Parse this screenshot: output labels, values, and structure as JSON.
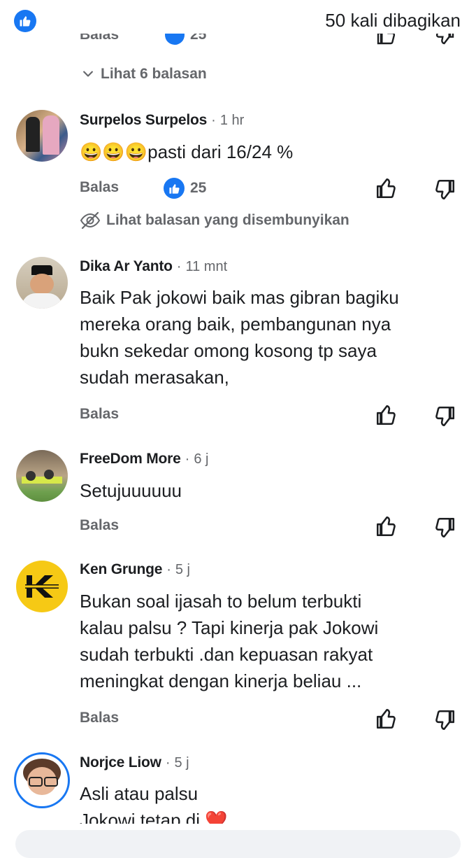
{
  "header": {
    "shares_text": "50 kali dibagikan"
  },
  "previous": {
    "view_replies": "Lihat 6 balasan"
  },
  "comments": [
    {
      "name": "Surpelos Surpelos",
      "time": "1 hr",
      "text_emoji": "😀😀😀",
      "text": "pasti dari  16/24 %",
      "reply_label": "Balas",
      "like_count": "25",
      "hidden_replies": "Lihat balasan yang disembunyikan"
    },
    {
      "name": "Dika Ar Yanto",
      "time": "11 mnt",
      "lines": [
        "Baik Pak jokowi baik mas gibran bagiku",
        "mereka orang baik, pembangunan nya",
        "bukn sekedar omong kosong tp saya",
        "sudah merasakan,"
      ],
      "reply_label": "Balas"
    },
    {
      "name": "FreeDom More",
      "time": "6 j",
      "lines": [
        "Setujuuuuuu"
      ],
      "reply_label": "Balas"
    },
    {
      "name": "Ken Grunge",
      "time": "5 j",
      "lines": [
        "Bukan soal ijasah to belum terbukti",
        "kalau palsu ? Tapi kinerja pak Jokowi",
        "sudah terbukti .dan kepuasan rakyat",
        "meningkat dengan kinerja beliau ..."
      ],
      "reply_label": "Balas"
    },
    {
      "name": "Norjce Liow",
      "time": "5 j",
      "lines": [
        "Asli atau palsu",
        "Jokowi tetap di"
      ],
      "heart": "❤️"
    }
  ],
  "colors": {
    "accent": "#1877f2",
    "secondary_text": "#65676b",
    "primary_text": "#1c1e21"
  }
}
